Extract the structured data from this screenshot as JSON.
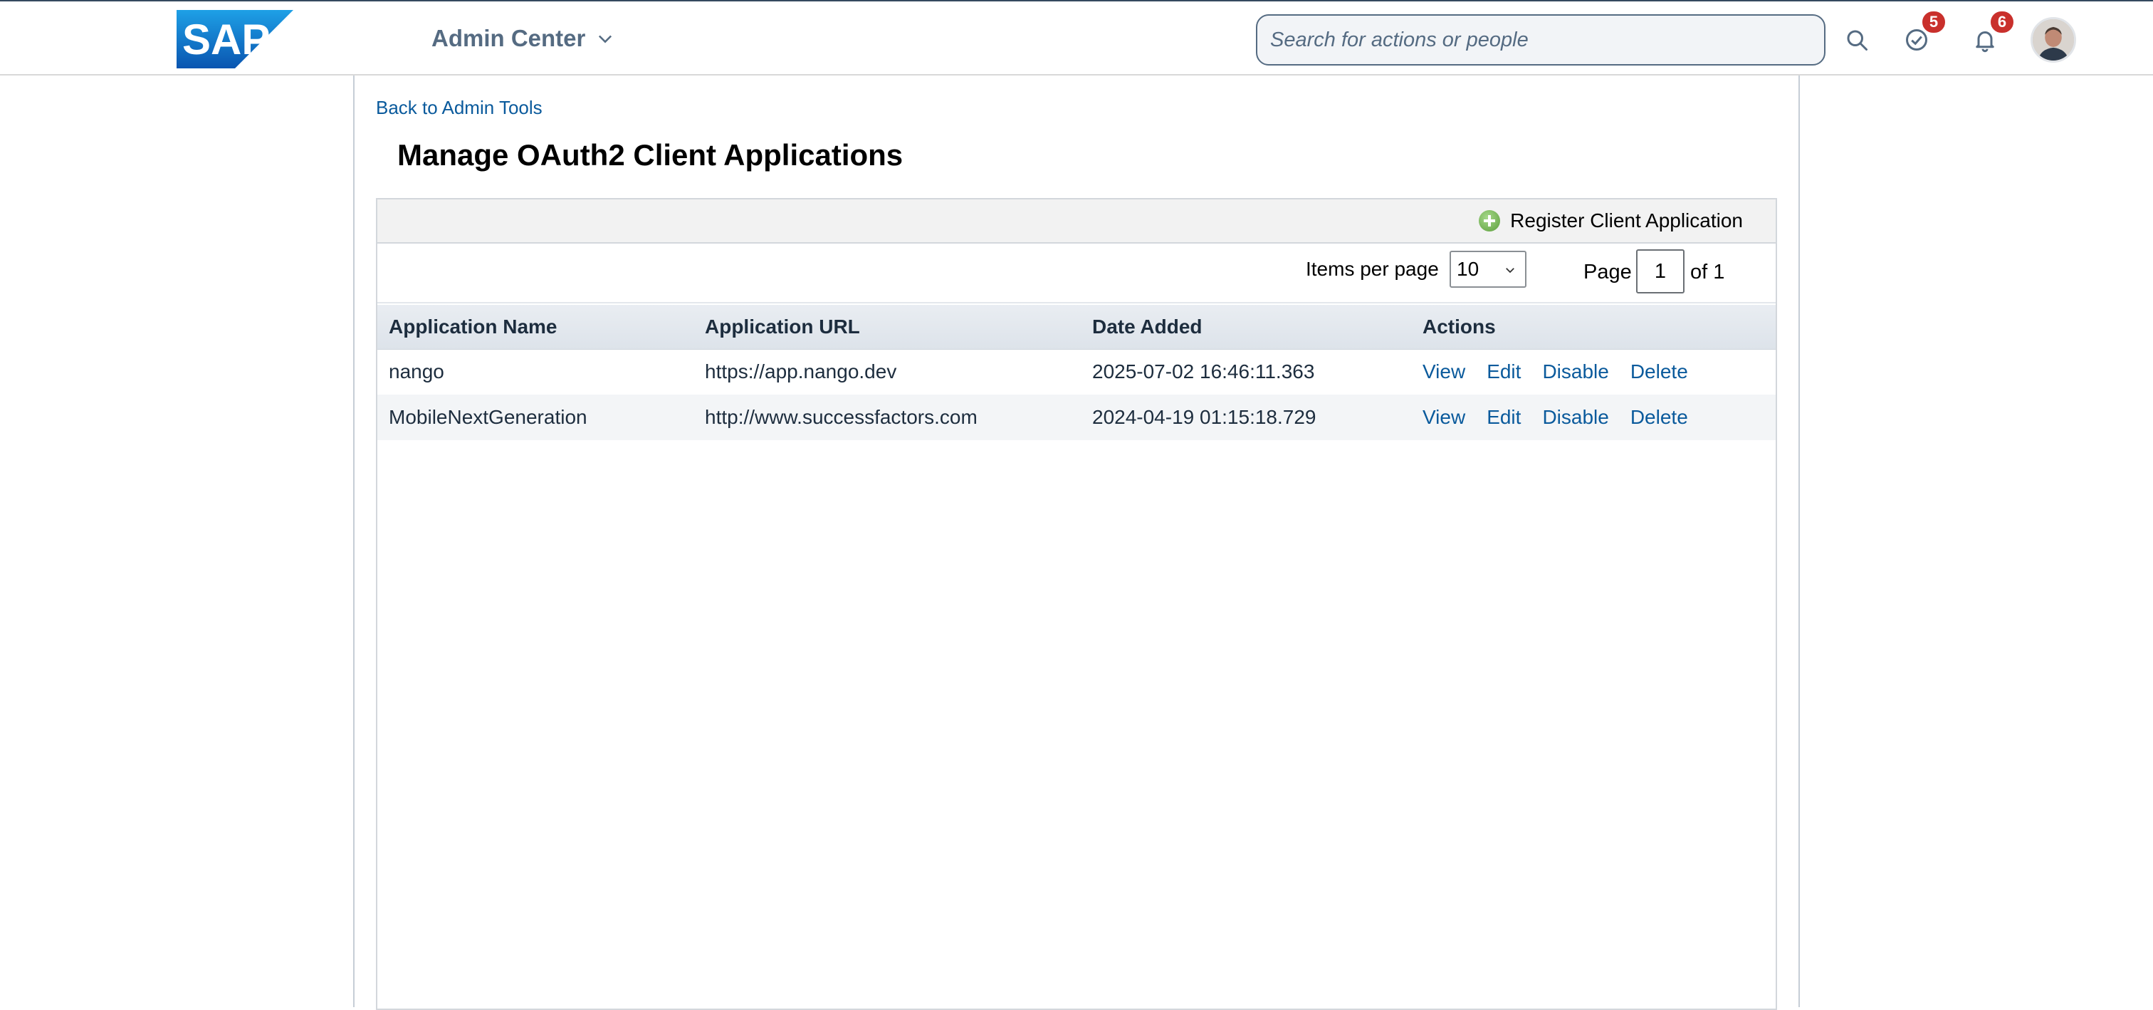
{
  "header": {
    "logo_text": "SAP",
    "app_title": "Admin Center",
    "search_placeholder": "Search for actions or people",
    "todo_badge": "5",
    "notifications_badge": "6"
  },
  "page": {
    "back_link": "Back to Admin Tools",
    "title": "Manage OAuth2 Client Applications"
  },
  "toolbar": {
    "register_label": "Register Client Application"
  },
  "pager": {
    "items_per_page_label": "Items per page",
    "items_per_page_value": "10",
    "page_label": "Page",
    "page_value": "1",
    "of_label": "of 1"
  },
  "table": {
    "columns": [
      "Application Name",
      "Application URL",
      "Date Added",
      "Actions"
    ],
    "rows": [
      {
        "name": "nango",
        "url": "https://app.nango.dev",
        "date": "2025-07-02 16:46:11.363",
        "actions": [
          "View",
          "Edit",
          "Disable",
          "Delete"
        ]
      },
      {
        "name": "MobileNextGeneration",
        "url": "http://www.successfactors.com",
        "date": "2024-04-19 01:15:18.729",
        "actions": [
          "View",
          "Edit",
          "Disable",
          "Delete"
        ]
      }
    ]
  },
  "colors": {
    "link": "#0a5a9c",
    "badge": "#c9302c",
    "header_text": "#556b82",
    "sap_blue": "#0f6fc5"
  }
}
